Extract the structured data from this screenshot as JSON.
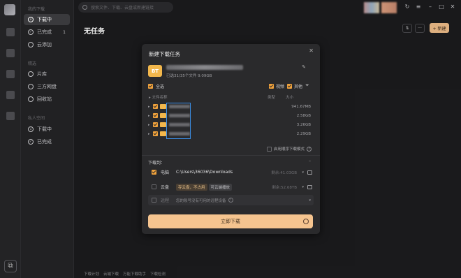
{
  "sidebar": {
    "section_my_downloads": "我的下载",
    "items": [
      {
        "label": "下载中"
      },
      {
        "label": "已完成",
        "badge": "1"
      },
      {
        "label": "云添加"
      }
    ],
    "section_library": "精选",
    "library_items": [
      {
        "label": "片库"
      },
      {
        "label": "三方网盘"
      },
      {
        "label": "回收站"
      }
    ],
    "section_private": "私人空间",
    "private_items": [
      {
        "label": "下载中"
      },
      {
        "label": "已完成"
      }
    ]
  },
  "search": {
    "placeholder": "搜索文件、下载、云盘或新建链接"
  },
  "header": {
    "title": "无任务",
    "new_label": "+ 新建"
  },
  "footer": {
    "items": [
      "下载计划",
      "云端下载",
      "万能下载助手",
      "下载检测"
    ]
  },
  "modal": {
    "title": "新建下载任务",
    "torrent_icon": "BT",
    "torrent_info": "已选31/35个文件 9.09GB",
    "select_all": "全选",
    "filter_video": "视频",
    "filter_other": "其他",
    "col_name": "文件名称",
    "col_type": "类型",
    "col_size": "大小",
    "files": [
      {
        "size": "941.67MB"
      },
      {
        "size": "2.58GB"
      },
      {
        "size": "3.26GB"
      },
      {
        "size": "2.29GB"
      }
    ],
    "sequential_label": "启用顺序下载模式",
    "save_to_label": "下载到：",
    "dest_pc_label": "电脑",
    "dest_pc_path": "C:\\Users\\36036\\Downloads",
    "dest_pc_free": "剩余:41.03GB",
    "dest_cloud_label": "云盘",
    "dest_cloud_tag": "存云盘，不占用",
    "dest_cloud_tag2": "可云端播放",
    "dest_cloud_free": "剩余:52.68TB",
    "dest_remote_label": "远程",
    "dest_remote_text": "您的账号没有可用的远程设备",
    "download_button": "立即下载"
  }
}
